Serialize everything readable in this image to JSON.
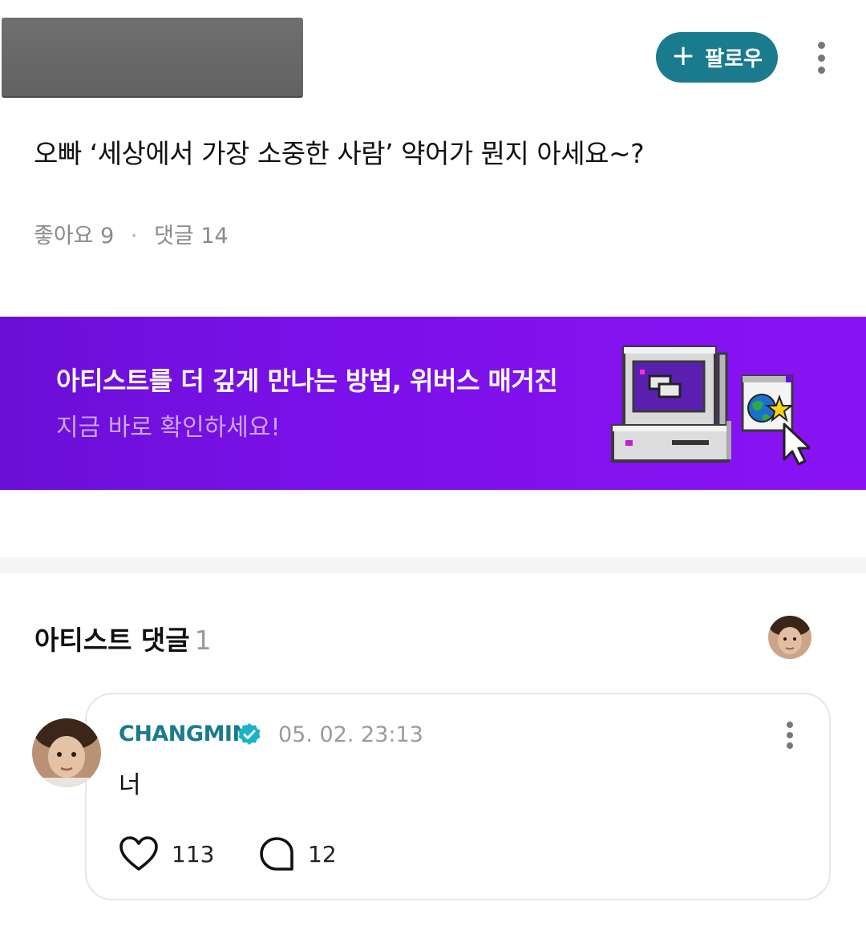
{
  "header": {
    "follow_label": "팔로우"
  },
  "post": {
    "title": "오빠 ‘세상에서 가장 소중한 사람’ 약어가 뭔지 아세요~?",
    "likes_label": "좋아요",
    "likes_count": "9",
    "separator": "·",
    "comments_label": "댓글",
    "comments_count": "14"
  },
  "banner": {
    "title": "아티스트를 더 깊게 만나는 방법, 위버스 매거진",
    "subtitle": "지금 바로 확인하세요!"
  },
  "artist_comments": {
    "section_title": "아티스트 댓글",
    "count": "1",
    "items": [
      {
        "author": "CHANGMIN",
        "timestamp": "05. 02. 23:13",
        "text": "너",
        "likes": "113",
        "replies": "12"
      }
    ]
  },
  "icons": [
    "plus-icon",
    "more-vertical-icon",
    "verified-badge-icon",
    "heart-icon",
    "comment-bubble-icon",
    "retro-computer-icon",
    "globe-star-icon",
    "cursor-arrow-icon"
  ],
  "colors": {
    "accent": "#1a7a8e",
    "banner_start": "#6a0fd6",
    "banner_end": "#8a13f4"
  }
}
